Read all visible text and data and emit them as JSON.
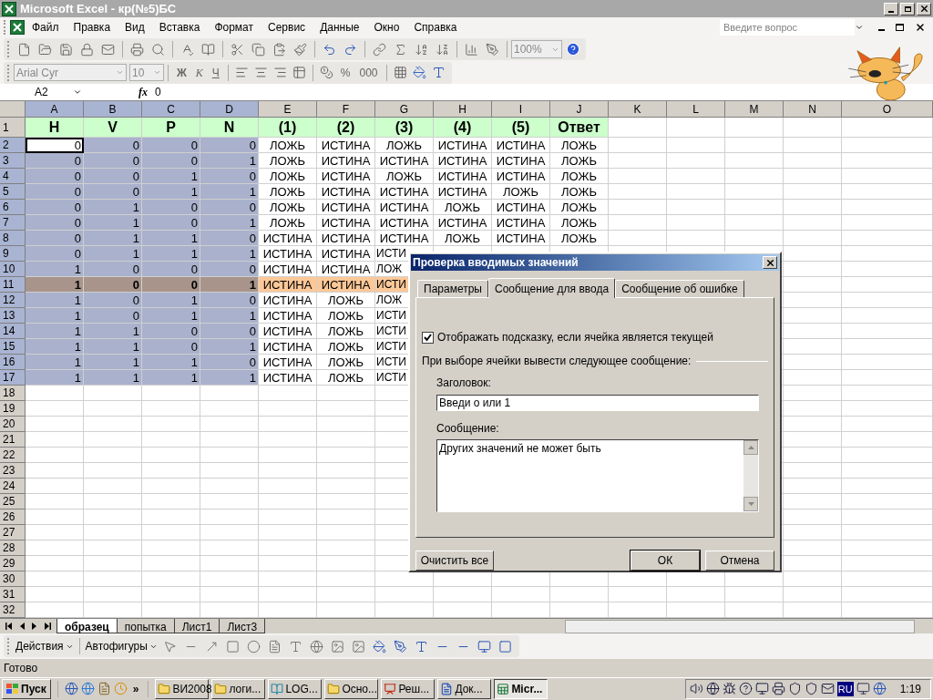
{
  "window": {
    "title": "Microsoft Excel - кр(№5)БС"
  },
  "menu": [
    "Файл",
    "Правка",
    "Вид",
    "Вставка",
    "Формат",
    "Сервис",
    "Данные",
    "Окно",
    "Справка"
  ],
  "help_search": {
    "placeholder": "Введите вопрос"
  },
  "toolbar": {
    "zoom": "100%"
  },
  "format_toolbar": {
    "font": "Arial Cyr",
    "size": "10",
    "bold": "Ж",
    "italic": "К",
    "underline": "Ч",
    "percent": "%",
    "thousands": "000"
  },
  "formula_bar": {
    "cell": "A2",
    "fx": "fx",
    "value": "0"
  },
  "columns": [
    {
      "label": "A",
      "selected": true,
      "kind": "number"
    },
    {
      "label": "B",
      "selected": true,
      "kind": "number"
    },
    {
      "label": "C",
      "selected": true,
      "kind": "number"
    },
    {
      "label": "D",
      "selected": true,
      "kind": "number"
    },
    {
      "label": "E",
      "selected": false,
      "kind": "text"
    },
    {
      "label": "F",
      "selected": false,
      "kind": "text"
    },
    {
      "label": "G",
      "selected": false,
      "kind": "text"
    },
    {
      "label": "H",
      "selected": false,
      "kind": "text"
    },
    {
      "label": "I",
      "selected": false,
      "kind": "text"
    },
    {
      "label": "J",
      "selected": false,
      "kind": "text"
    },
    {
      "label": "K",
      "selected": false,
      "kind": "text"
    },
    {
      "label": "L",
      "selected": false,
      "kind": "text"
    },
    {
      "label": "M",
      "selected": false,
      "kind": "text"
    },
    {
      "label": "N",
      "selected": false,
      "kind": "text"
    },
    {
      "label": "O",
      "selected": false,
      "kind": "text"
    }
  ],
  "rows": [
    {
      "number": "1",
      "kind": "header",
      "selected": false,
      "cells": [
        "H",
        "V",
        "P",
        "N",
        "(1)",
        "(2)",
        "(3)",
        "(4)",
        "(5)",
        "Ответ"
      ]
    },
    {
      "number": "2",
      "kind": "current",
      "selected": true,
      "cells": [
        "0",
        "0",
        "0",
        "0",
        "ЛОЖЬ",
        "ИСТИНА",
        "ЛОЖЬ",
        "ИСТИНА",
        "ИСТИНА",
        "ЛОЖЬ"
      ]
    },
    {
      "number": "3",
      "kind": "data",
      "selected": true,
      "cells": [
        "0",
        "0",
        "0",
        "1",
        "ЛОЖЬ",
        "ИСТИНА",
        "ИСТИНА",
        "ИСТИНА",
        "ИСТИНА",
        "ЛОЖЬ"
      ]
    },
    {
      "number": "4",
      "kind": "data",
      "selected": true,
      "cells": [
        "0",
        "0",
        "1",
        "0",
        "ЛОЖЬ",
        "ИСТИНА",
        "ЛОЖЬ",
        "ИСТИНА",
        "ИСТИНА",
        "ЛОЖЬ"
      ]
    },
    {
      "number": "5",
      "kind": "data",
      "selected": true,
      "cells": [
        "0",
        "0",
        "1",
        "1",
        "ЛОЖЬ",
        "ИСТИНА",
        "ИСТИНА",
        "ИСТИНА",
        "ЛОЖЬ",
        "ЛОЖЬ"
      ]
    },
    {
      "number": "6",
      "kind": "data",
      "selected": true,
      "cells": [
        "0",
        "1",
        "0",
        "0",
        "ЛОЖЬ",
        "ИСТИНА",
        "ИСТИНА",
        "ЛОЖЬ",
        "ИСТИНА",
        "ЛОЖЬ"
      ]
    },
    {
      "number": "7",
      "kind": "data",
      "selected": true,
      "cells": [
        "0",
        "1",
        "0",
        "1",
        "ЛОЖЬ",
        "ИСТИНА",
        "ИСТИНА",
        "ИСТИНА",
        "ИСТИНА",
        "ЛОЖЬ"
      ]
    },
    {
      "number": "8",
      "kind": "data",
      "selected": true,
      "cells": [
        "0",
        "1",
        "1",
        "0",
        "ИСТИНА",
        "ИСТИНА",
        "ИСТИНА",
        "ЛОЖЬ",
        "ИСТИНА",
        "ЛОЖЬ"
      ]
    },
    {
      "number": "9",
      "kind": "data",
      "selected": true,
      "cells": [
        "0",
        "1",
        "1",
        "1",
        "ИСТИНА",
        "ИСТИНА",
        "ИСТИ"
      ]
    },
    {
      "number": "10",
      "kind": "data",
      "selected": true,
      "cells": [
        "1",
        "0",
        "0",
        "0",
        "ИСТИНА",
        "ИСТИНА",
        "ЛОЖ"
      ]
    },
    {
      "number": "11",
      "kind": "highlighted",
      "selected": true,
      "cells": [
        "1",
        "0",
        "0",
        "1",
        "ИСТИНА",
        "ИСТИНА",
        "ИСТИ"
      ]
    },
    {
      "number": "12",
      "kind": "data",
      "selected": true,
      "cells": [
        "1",
        "0",
        "1",
        "0",
        "ИСТИНА",
        "ЛОЖЬ",
        "ЛОЖ"
      ]
    },
    {
      "number": "13",
      "kind": "data",
      "selected": true,
      "cells": [
        "1",
        "0",
        "1",
        "1",
        "ИСТИНА",
        "ЛОЖЬ",
        "ИСТИ"
      ]
    },
    {
      "number": "14",
      "kind": "data",
      "selected": true,
      "cells": [
        "1",
        "1",
        "0",
        "0",
        "ИСТИНА",
        "ЛОЖЬ",
        "ИСТИ"
      ]
    },
    {
      "number": "15",
      "kind": "data",
      "selected": true,
      "cells": [
        "1",
        "1",
        "0",
        "1",
        "ИСТИНА",
        "ЛОЖЬ",
        "ИСТИ"
      ]
    },
    {
      "number": "16",
      "kind": "data",
      "selected": true,
      "cells": [
        "1",
        "1",
        "1",
        "0",
        "ИСТИНА",
        "ЛОЖЬ",
        "ИСТИ"
      ]
    },
    {
      "number": "17",
      "kind": "data",
      "selected": true,
      "cells": [
        "1",
        "1",
        "1",
        "1",
        "ИСТИНА",
        "ЛОЖЬ",
        "ИСТИ"
      ]
    },
    {
      "number": "18",
      "kind": "data",
      "selected": false,
      "cells": []
    },
    {
      "number": "19",
      "kind": "data",
      "selected": false,
      "cells": []
    },
    {
      "number": "20",
      "kind": "data",
      "selected": false,
      "cells": []
    },
    {
      "number": "21",
      "kind": "data",
      "selected": false,
      "cells": []
    },
    {
      "number": "22",
      "kind": "data",
      "selected": false,
      "cells": []
    },
    {
      "number": "23",
      "kind": "data",
      "selected": false,
      "cells": []
    },
    {
      "number": "24",
      "kind": "data",
      "selected": false,
      "cells": []
    },
    {
      "number": "25",
      "kind": "data",
      "selected": false,
      "cells": []
    },
    {
      "number": "26",
      "kind": "data",
      "selected": false,
      "cells": []
    },
    {
      "number": "27",
      "kind": "data",
      "selected": false,
      "cells": []
    },
    {
      "number": "28",
      "kind": "data",
      "selected": false,
      "cells": []
    },
    {
      "number": "29",
      "kind": "data",
      "selected": false,
      "cells": []
    },
    {
      "number": "30",
      "kind": "data",
      "selected": false,
      "cells": []
    },
    {
      "number": "31",
      "kind": "data",
      "selected": false,
      "cells": []
    },
    {
      "number": "32",
      "kind": "data",
      "selected": false,
      "cells": []
    }
  ],
  "sheet_tabs": [
    {
      "label": "образец",
      "selected": true
    },
    {
      "label": "попытка",
      "selected": false
    },
    {
      "label": "Лист1",
      "selected": false
    },
    {
      "label": "Лист3",
      "selected": false
    }
  ],
  "drawing_toolbar": {
    "actions": "Действия",
    "autoshapes": "Автофигуры"
  },
  "status_bar": "Готово",
  "dialog": {
    "title": "Проверка вводимых значений",
    "tabs": [
      {
        "label": "Параметры",
        "selected": false
      },
      {
        "label": "Сообщение для ввода",
        "selected": true
      },
      {
        "label": "Сообщение об ошибке",
        "selected": false
      }
    ],
    "show_hint": {
      "label": "Отображать подсказку, если ячейка является текущей",
      "checked": true
    },
    "group_label": "При выборе ячейки вывести следующее сообщение:",
    "title_label": "Заголовок:",
    "title_value": "Введи о или 1",
    "message_label": "Сообщение:",
    "message_value": "Других значений не может быть",
    "buttons": [
      "Очистить все",
      "ОК",
      "Отмена"
    ]
  },
  "taskbar": {
    "start": "Пуск",
    "more": "»",
    "tasks": [
      {
        "label": "ВИ2008",
        "kind": "folder",
        "selected": false
      },
      {
        "label": "логи...",
        "kind": "folder",
        "selected": false
      },
      {
        "label": "LOG...",
        "kind": "book",
        "selected": false
      },
      {
        "label": "Осно...",
        "kind": "folder",
        "selected": false
      },
      {
        "label": "Реш...",
        "kind": "slides",
        "selected": false
      },
      {
        "label": "Док...",
        "kind": "doc",
        "selected": false
      },
      {
        "label": "Micr...",
        "kind": "sheet",
        "selected": true
      }
    ],
    "language": "RU",
    "clock": "1:19"
  }
}
